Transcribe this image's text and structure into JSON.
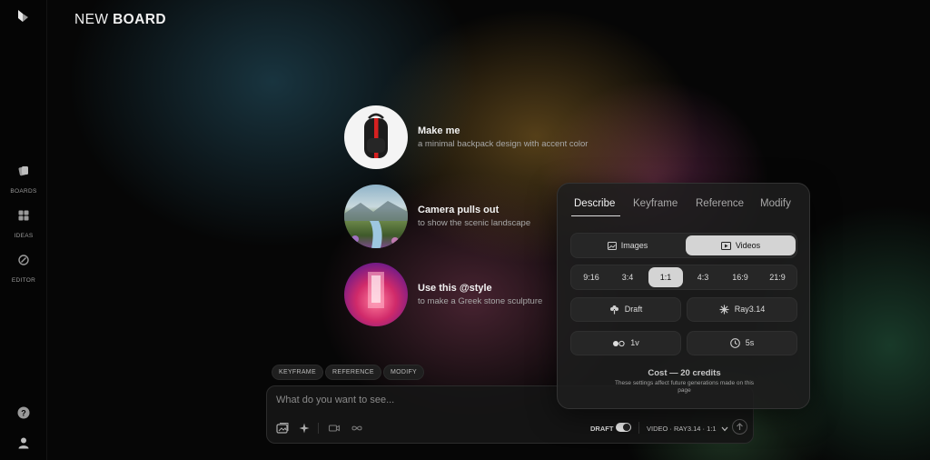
{
  "board": {
    "title_prefix": "NEW",
    "title_bold": "BOARD"
  },
  "sidebar": {
    "items": [
      {
        "label": "BOARDS",
        "icon": "boards-icon"
      },
      {
        "label": "IDEAS",
        "icon": "ideas-icon"
      },
      {
        "label": "EDITOR",
        "icon": "editor-icon"
      }
    ],
    "help_icon": "help-icon",
    "profile_icon": "profile-icon"
  },
  "suggestions": [
    {
      "title": "Make me",
      "subtitle": "a minimal backpack design with accent color"
    },
    {
      "title": "Camera pulls out",
      "subtitle": "to show the scenic landscape"
    },
    {
      "title": "Use this @style",
      "subtitle": "to make a Greek stone sculpture"
    }
  ],
  "chips": [
    "KEYFRAME",
    "REFERENCE",
    "MODIFY"
  ],
  "prompt": {
    "placeholder": "What do you want to see...",
    "draft_label": "DRAFT",
    "draft_on": true,
    "model_selector": "VIDEO · RAY3.14 · 1:1"
  },
  "panel": {
    "tabs": [
      "Describe",
      "Keyframe",
      "Reference",
      "Modify"
    ],
    "active_tab": "Describe",
    "media_types": [
      "Images",
      "Videos"
    ],
    "selected_media": "Videos",
    "aspect_ratios": [
      "9:16",
      "3:4",
      "1:1",
      "4:3",
      "16:9",
      "21:9"
    ],
    "selected_ratio": "1:1",
    "quality": "Draft",
    "model": "Ray3.14",
    "variations": "1v",
    "duration": "5s",
    "cost": "Cost — 20 credits",
    "cost_note": "These settings affect future generations made on this page"
  },
  "colors": {
    "accent": "#d4d4d4",
    "background": "#050505",
    "panel": "#1e1e1e"
  }
}
